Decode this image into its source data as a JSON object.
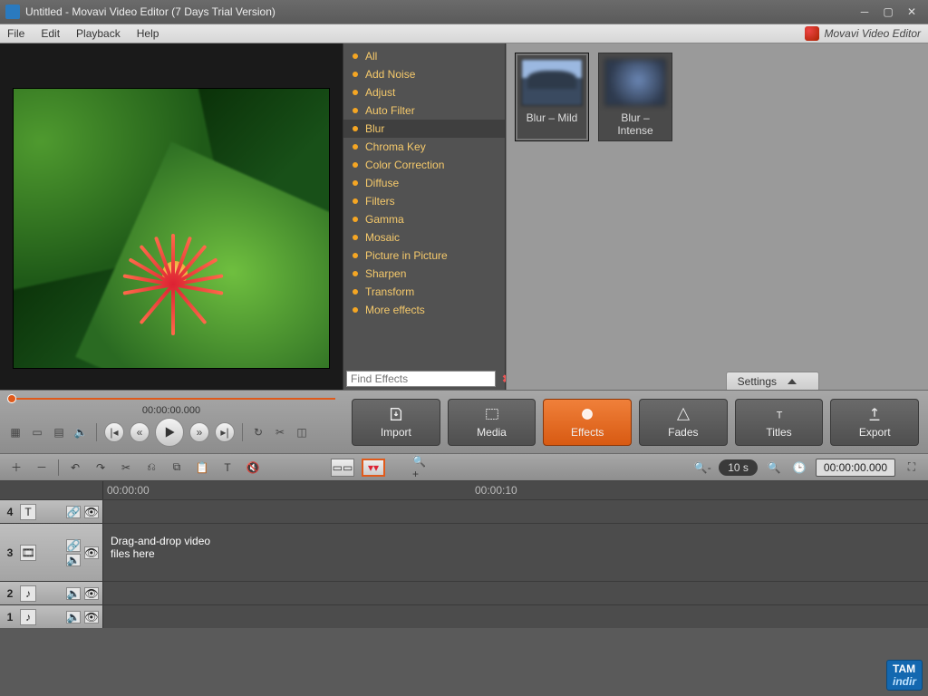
{
  "window": {
    "title": "Untitled - Movavi Video Editor (7 Days Trial Version)"
  },
  "menu": {
    "file": "File",
    "edit": "Edit",
    "playback": "Playback",
    "help": "Help",
    "brand": "Movavi Video Editor"
  },
  "preview": {
    "timecode": "00:00:00.000"
  },
  "effects": {
    "items": [
      "All",
      "Add Noise",
      "Adjust",
      "Auto Filter",
      "Blur",
      "Chroma Key",
      "Color Correction",
      "Diffuse",
      "Filters",
      "Gamma",
      "Mosaic",
      "Picture in Picture",
      "Sharpen",
      "Transform",
      "More effects"
    ],
    "selected_index": 4,
    "find_placeholder": "Find Effects"
  },
  "thumbs": {
    "items": [
      "Blur – Mild",
      "Blur – Intense"
    ],
    "settings_label": "Settings"
  },
  "tabs": {
    "import": "Import",
    "media": "Media",
    "effects": "Effects",
    "fades": "Fades",
    "titles": "Titles",
    "export": "Export",
    "active": "effects"
  },
  "tl_toolbar": {
    "scale": "10 s",
    "time": "00:00:00.000"
  },
  "ruler": {
    "t0": "00:00:00",
    "t1": "00:00:10"
  },
  "tracks": {
    "t4": "4",
    "t3": "3",
    "t2": "2",
    "t1": "1",
    "drop_hint": "Drag-and-drop video files here"
  },
  "watermark": {
    "a": "TAM",
    "b": "indir"
  }
}
